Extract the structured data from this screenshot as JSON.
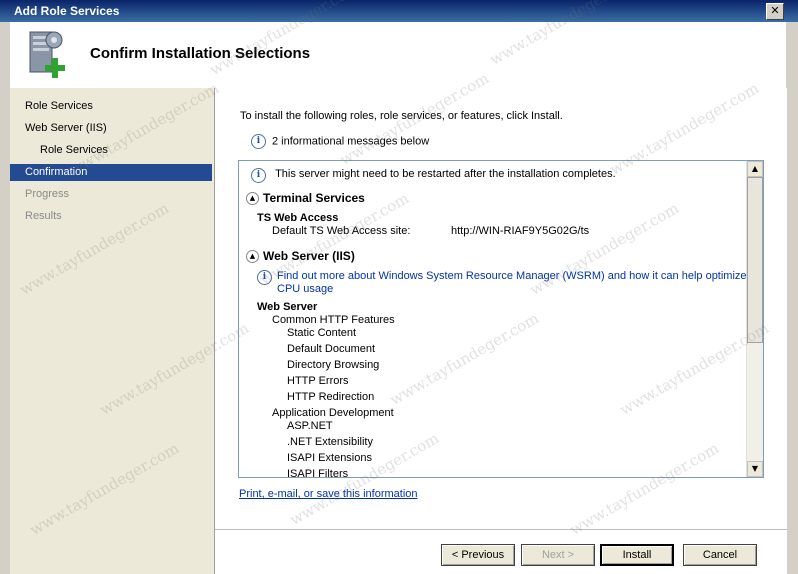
{
  "window": {
    "title": "Add Role Services",
    "close_label": "✕"
  },
  "header": {
    "title": "Confirm Installation Selections"
  },
  "nav": {
    "items": [
      {
        "label": "Role Services",
        "state": "normal"
      },
      {
        "label": "Web Server (IIS)",
        "state": "normal"
      },
      {
        "label": "Role Services",
        "state": "normal"
      },
      {
        "label": "Confirmation",
        "state": "active"
      },
      {
        "label": "Progress",
        "state": "disabled"
      },
      {
        "label": "Results",
        "state": "disabled"
      }
    ]
  },
  "main": {
    "intro": "To install the following roles, role services, or features, click Install.",
    "info_count": "2 informational messages below",
    "restart_note": "This server might need to be restarted after the installation completes.",
    "sections": {
      "terminal_services": {
        "title": "Terminal Services",
        "subtitle": "TS Web Access",
        "site_label": "Default TS Web Access site:",
        "site_value": "http://WIN-RIAF9Y5G02G/ts"
      },
      "web_server": {
        "title": "Web Server (IIS)",
        "wsrm_link_line1": "Find out more about Windows System Resource Manager (WSRM) and how it can help optimize",
        "wsrm_link_line2": "CPU usage",
        "heading": "Web Server",
        "items": [
          {
            "label": "Common HTTP Features",
            "level": 1
          },
          {
            "label": "Static Content",
            "level": 2
          },
          {
            "label": "Default Document",
            "level": 2
          },
          {
            "label": "Directory Browsing",
            "level": 2
          },
          {
            "label": "HTTP Errors",
            "level": 2
          },
          {
            "label": "HTTP Redirection",
            "level": 2
          },
          {
            "label": "Application Development",
            "level": 1
          },
          {
            "label": "ASP.NET",
            "level": 2
          },
          {
            "label": ".NET Extensibility",
            "level": 2
          },
          {
            "label": "ISAPI Extensions",
            "level": 2
          },
          {
            "label": "ISAPI Filters",
            "level": 2
          }
        ]
      }
    },
    "print_link": "Print, e-mail, or save this information"
  },
  "buttons": {
    "previous": "< Previous",
    "next": "Next >",
    "install": "Install",
    "cancel": "Cancel"
  },
  "watermark": "www.tayfundeger.com",
  "icons": {
    "info": "info-icon",
    "collapse": "collapse-icon",
    "scroll_up": "scroll-up-icon",
    "scroll_down": "scroll-down-icon",
    "server_add": "server-add-icon"
  }
}
